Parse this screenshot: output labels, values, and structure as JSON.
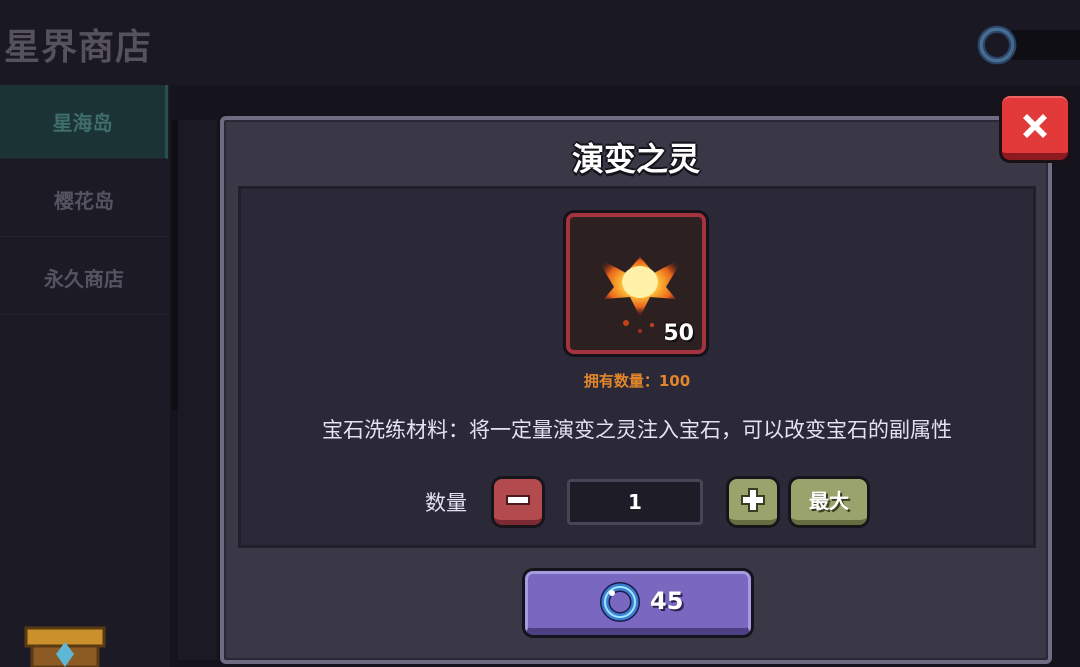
{
  "shop": {
    "title": "星界商店",
    "currency_icon": "gem-ring-icon"
  },
  "sidebar": {
    "items": [
      {
        "label": "星海岛",
        "active": true
      },
      {
        "label": "樱花岛",
        "active": false
      },
      {
        "label": "永久商店",
        "active": false
      }
    ]
  },
  "modal": {
    "title": "演变之灵",
    "item": {
      "icon": "evolution-spirit-icon",
      "stack_count": "50",
      "owned_text": "拥有数量：100"
    },
    "description": "宝石洗练材料：将一定量演变之灵注入宝石，可以改变宝石的副属性",
    "quantity": {
      "label": "数量",
      "value": "1",
      "max_label": "最大"
    },
    "buy": {
      "price": "45",
      "currency_icon": "gem-ring-icon"
    }
  },
  "colors": {
    "accent_purple": "#7a68c0",
    "close_red": "#e23a3a",
    "owned_orange": "#e3862b",
    "plus_green": "#9aa36c",
    "minus_red": "#b34a4e"
  }
}
